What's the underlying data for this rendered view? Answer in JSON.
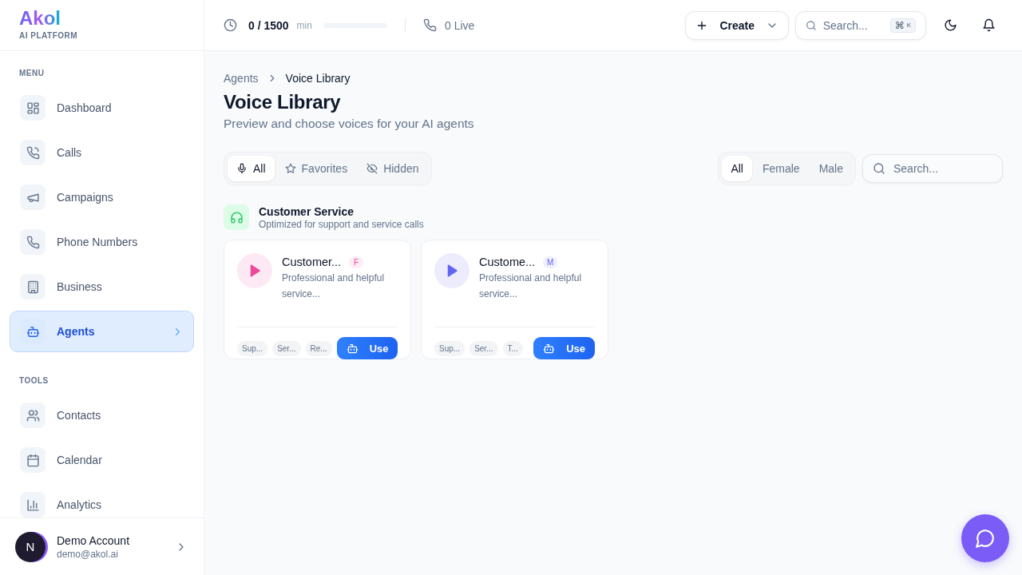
{
  "brand": {
    "name": "Akol",
    "tagline": "AI PLATFORM"
  },
  "sidebar": {
    "sections": [
      {
        "heading": "MENU",
        "items": [
          {
            "label": "Dashboard",
            "selected": false
          },
          {
            "label": "Calls",
            "selected": false
          },
          {
            "label": "Campaigns",
            "selected": false
          },
          {
            "label": "Phone Numbers",
            "selected": false
          },
          {
            "label": "Business",
            "selected": false
          },
          {
            "label": "Agents",
            "selected": true
          }
        ]
      },
      {
        "heading": "TOOLS",
        "items": [
          {
            "label": "Contacts",
            "selected": false
          },
          {
            "label": "Calendar",
            "selected": false
          },
          {
            "label": "Analytics",
            "selected": false
          }
        ]
      }
    ],
    "account": {
      "initial": "N",
      "name": "Demo Account",
      "email": "demo@akol.ai"
    }
  },
  "topbar": {
    "usage": {
      "value": "0 / 1500",
      "unit": "min",
      "level": 0
    },
    "live": "0 Live",
    "create": "Create",
    "search": {
      "placeholder": "Search...",
      "shortcut_symbol": "⌘",
      "shortcut_key": "K"
    }
  },
  "breadcrumb": [
    "Agents",
    "Voice Library"
  ],
  "page": {
    "title": "Voice Library",
    "subtitle": "Preview and choose voices for your AI agents"
  },
  "filters": [
    {
      "label": "All",
      "selected": true
    },
    {
      "label": "Favorites",
      "selected": false
    },
    {
      "label": "Hidden",
      "selected": false
    }
  ],
  "gender_filters": [
    {
      "label": "All",
      "selected": true
    },
    {
      "label": "Female",
      "selected": false
    },
    {
      "label": "Male",
      "selected": false
    }
  ],
  "voice_search": {
    "placeholder": "Search..."
  },
  "category": {
    "title": "Customer Service",
    "description": "Optimized for support and service calls"
  },
  "voices": [
    {
      "name": "Customer...",
      "gender": "F",
      "color": "#ec4899",
      "description": "Professional and helpful service...",
      "tags": [
        "Sup...",
        "Ser...",
        "Re..."
      ],
      "action": "Use"
    },
    {
      "name": "Custome...",
      "gender": "M",
      "color": "#6366f1",
      "description": "Professional and helpful service...",
      "tags": [
        "Sup...",
        "Ser...",
        "T..."
      ],
      "action": "Use"
    }
  ]
}
